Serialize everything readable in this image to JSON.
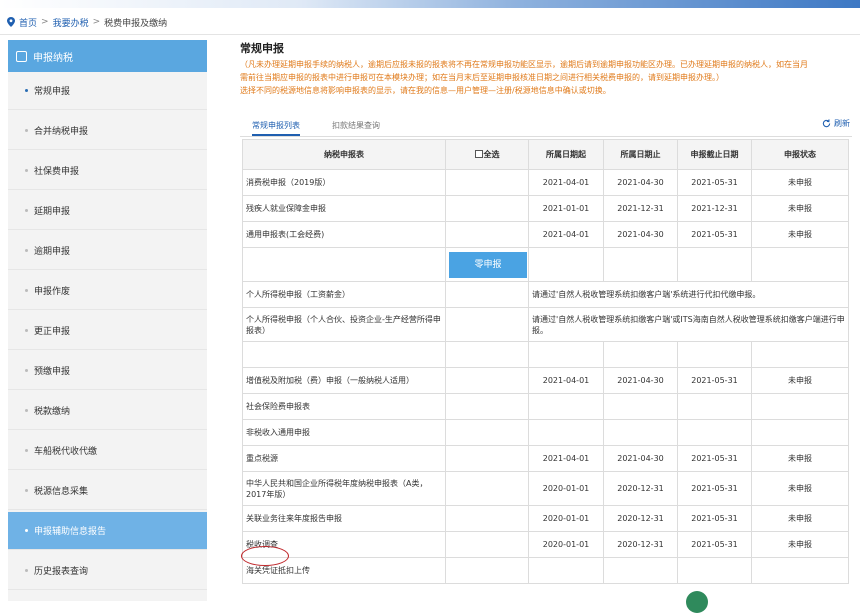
{
  "breadcrumb": [
    "首页",
    "我要办税",
    "税费申报及缴纳"
  ],
  "sidebar": {
    "header": "申报纳税",
    "items": [
      {
        "label": "常规申报",
        "state": "active"
      },
      {
        "label": "合并纳税申报"
      },
      {
        "label": "社保费申报"
      },
      {
        "label": "延期申报"
      },
      {
        "label": "逾期申报"
      },
      {
        "label": "申报作废"
      },
      {
        "label": "更正申报"
      },
      {
        "label": "预缴申报"
      },
      {
        "label": "税款缴纳"
      },
      {
        "label": "车船税代收代缴"
      },
      {
        "label": "税源信息采集"
      },
      {
        "label": "申报辅助信息报告",
        "state": "selected"
      },
      {
        "label": "历史报表查询"
      }
    ]
  },
  "main": {
    "title": "常规申报",
    "notice_line1": "（凡未办理延期申报手续的纳税人，逾期后应报未报的报表将不再在常规申报功能区显示，逾期后请到逾期申报功能区办理。已办理延期申报的纳税人，如在当月",
    "notice_line2": "需前往当期应申报的报表中进行申报可在本模块办理；如在当月末后至延期申报核准日期之间进行相关税费申报的，请到延期申报办理。）",
    "notice_line3": "选择不同的税源地信息将影响申报表的显示，请在我的信息—用户管理—注册/税源地信息中确认或切换。",
    "tabs": [
      "常规申报列表",
      "扣款结果查询"
    ],
    "refresh": "刷新"
  },
  "table": {
    "headers": [
      "纳税申报表",
      "全选",
      "所属日期起",
      "所属日期止",
      "申报截止日期",
      "申报状态"
    ],
    "rows": [
      {
        "name": "消费税申报（2019版）",
        "start": "2021-04-01",
        "end": "2021-04-30",
        "deadline": "2021-05-31",
        "status": "未申报"
      },
      {
        "name": "残疾人就业保障金申报",
        "start": "2021-01-01",
        "end": "2021-12-31",
        "deadline": "2021-12-31",
        "status": "未申报"
      },
      {
        "name": "通用申报表(工会经费)",
        "start": "2021-04-01",
        "end": "2021-04-30",
        "deadline": "2021-05-31",
        "status": "未申报"
      }
    ],
    "zero_button": "零申报",
    "personal_rows": [
      {
        "name": "个人所得税申报（工资薪金）",
        "note": "请通过'自然人税收管理系统扣缴客户端'系统进行代扣代缴申报。"
      },
      {
        "name": "个人所得税申报（个人合伙、投资企业-生产经营所得申报表）",
        "note": "请通过'自然人税收管理系统扣缴客户端'或ITS海南自然人税收管理系统扣缴客户端进行申报。"
      }
    ],
    "rows2": [
      {
        "name": "增值税及附加税（费）申报（一般纳税人适用）",
        "start": "2021-04-01",
        "end": "2021-04-30",
        "deadline": "2021-05-31",
        "status": "未申报"
      },
      {
        "name": "社会保险费申报表",
        "start": "",
        "end": "",
        "deadline": "",
        "status": ""
      },
      {
        "name": "非税收入通用申报",
        "start": "",
        "end": "",
        "deadline": "",
        "status": ""
      },
      {
        "name": "重点税源",
        "start": "2021-04-01",
        "end": "2021-04-30",
        "deadline": "2021-05-31",
        "status": "未申报"
      },
      {
        "name": "中华人民共和国企业所得税年度纳税申报表（A类，2017年版）",
        "start": "2020-01-01",
        "end": "2020-12-31",
        "deadline": "2021-05-31",
        "status": "未申报"
      },
      {
        "name": "关联业务往来年度报告申报",
        "start": "2020-01-01",
        "end": "2020-12-31",
        "deadline": "2021-05-31",
        "status": "未申报"
      },
      {
        "name": "税收调查",
        "start": "2020-01-01",
        "end": "2020-12-31",
        "deadline": "2021-05-31",
        "status": "未申报"
      },
      {
        "name": "海关凭证抵扣上传",
        "start": "",
        "end": "",
        "deadline": "",
        "status": ""
      }
    ]
  },
  "colors": {
    "accent": "#1f5fb0",
    "sidebar_header": "#5aa7e0",
    "sidebar_selected": "#6fb2e6",
    "notice": "#e07a1a",
    "circle": "#c0282c"
  }
}
